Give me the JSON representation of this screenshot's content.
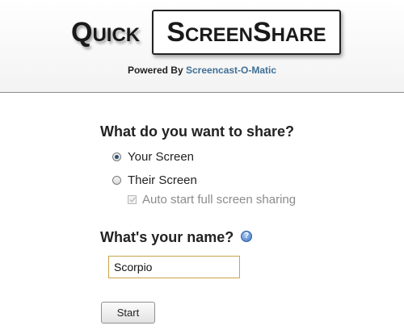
{
  "header": {
    "logo_quick": "Quick",
    "logo_screenshare": "ScreenShare",
    "powered_prefix": "Powered By",
    "powered_link": "Screencast-O-Matic"
  },
  "share": {
    "question": "What do you want to share?",
    "options": [
      {
        "label": "Your Screen",
        "selected": true
      },
      {
        "label": "Their Screen",
        "selected": false
      }
    ],
    "auto_start": {
      "label": "Auto start full screen sharing",
      "checked": true,
      "disabled": true
    }
  },
  "name": {
    "question": "What's your name?",
    "help_icon": "help-icon",
    "help_glyph": "?",
    "value": "Scorpio"
  },
  "actions": {
    "start_label": "Start"
  },
  "colors": {
    "link": "#3f6f96",
    "input_border": "#c9a44a",
    "disabled_text": "#8c8c8c"
  }
}
